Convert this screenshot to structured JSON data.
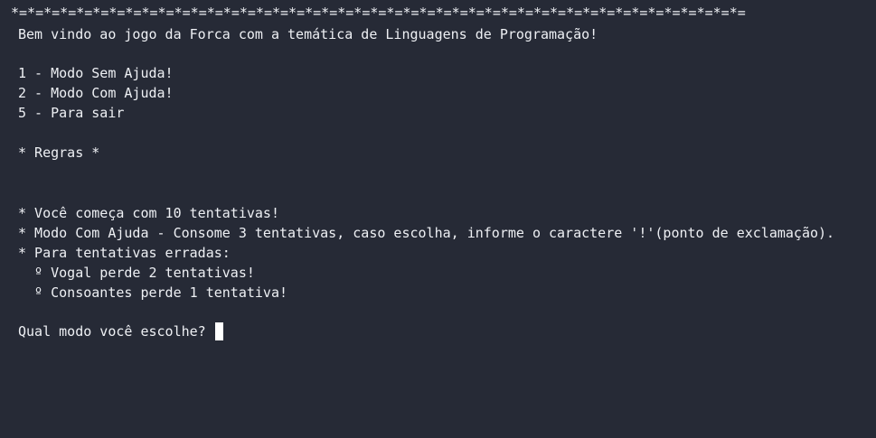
{
  "terminal": {
    "background": "#262a36",
    "foreground": "#eef0f4",
    "banner": "*=*=*=*=*=*=*=*=*=*=*=*=*=*=*=*=*=*=*=*=*=*=*=*=*=*=*=*=*=*=*=*=*=*=*=*=*=*=*=*=*=*=*=*=*=",
    "welcome": "Bem vindo ao jogo da Forca com a temática de Linguagens de Programação!",
    "menu": {
      "option_1": "1 - Modo Sem Ajuda!",
      "option_2": "2 - Modo Com Ajuda!",
      "option_5": "5 - Para sair"
    },
    "rules_header": "* Regras *",
    "rules": {
      "rule_1": "* Você começa com 10 tentativas!",
      "rule_2": "* Modo Com Ajuda - Consome 3 tentativas, caso escolha, informe o caractere '!'(ponto de exclamação).",
      "rule_3": "* Para tentativas erradas:",
      "sub_rule_1": "  º Vogal perde 2 tentativas!",
      "sub_rule_2": "  º Consoantes perde 1 tentativa!"
    },
    "prompt": "Qual modo você escolhe? "
  }
}
